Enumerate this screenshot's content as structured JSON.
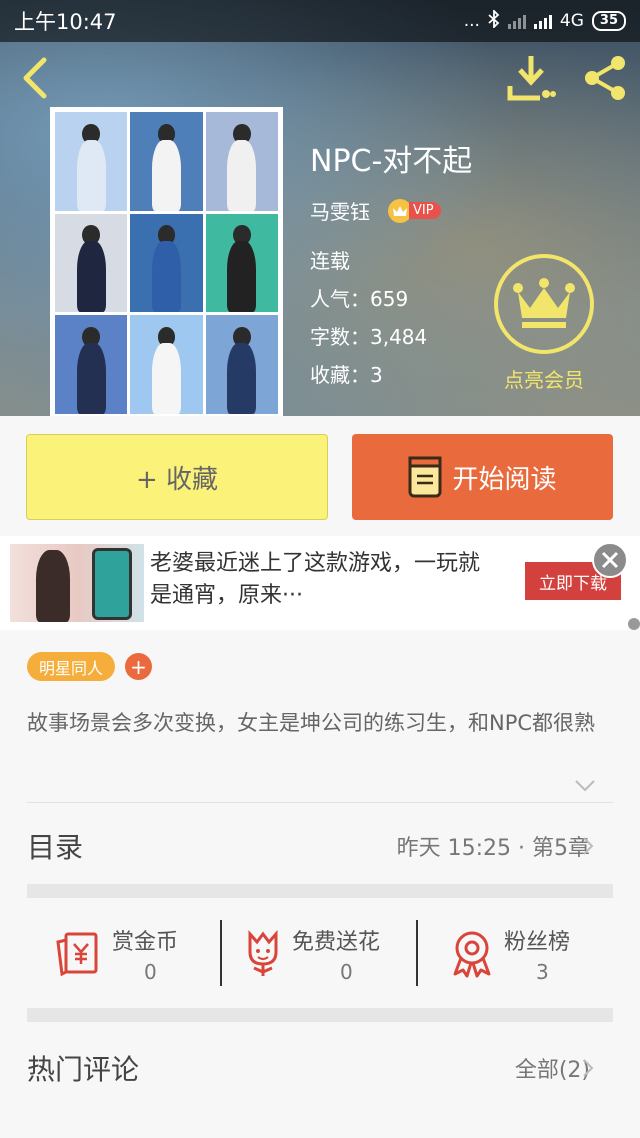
{
  "status_bar": {
    "time": "上午10:47",
    "dots": "...",
    "network": "4G",
    "battery": "35"
  },
  "book": {
    "title": "NPC-对不起",
    "author": "马雯钰",
    "vip_label": "VIP",
    "status": "连载",
    "popularity": "人气：659",
    "word_count": "字数：3,484",
    "favorites": "收藏：3"
  },
  "member": {
    "label": "点亮会员",
    "color": "#f2e56c"
  },
  "actions": {
    "collect_label": "+ 收藏",
    "read_label": "开始阅读"
  },
  "ad": {
    "text": "老婆最近迷上了这款游戏，一玩就是通宵，原来···",
    "button_label": "立即下载"
  },
  "tags": {
    "items": [
      "明星同人"
    ],
    "add_symbol": "+"
  },
  "description": "故事场景会多次变换，女主是坤公司的练习生，和NPC都很熟",
  "toc": {
    "title": "目录",
    "latest": "昨天 15:25 · 第5章"
  },
  "stats": {
    "reward": {
      "label": "赏金币",
      "value": "0"
    },
    "flowers": {
      "label": "免费送花",
      "value": "0"
    },
    "fans": {
      "label": "粉丝榜",
      "value": "3"
    }
  },
  "comments": {
    "title": "热门评论",
    "all_label": "全部(2)"
  },
  "colors": {
    "accent_orange": "#e96a3c",
    "collect_yellow": "#fbf27a",
    "tag_orange": "#f5ae3c",
    "icon_red": "#d9443b"
  }
}
